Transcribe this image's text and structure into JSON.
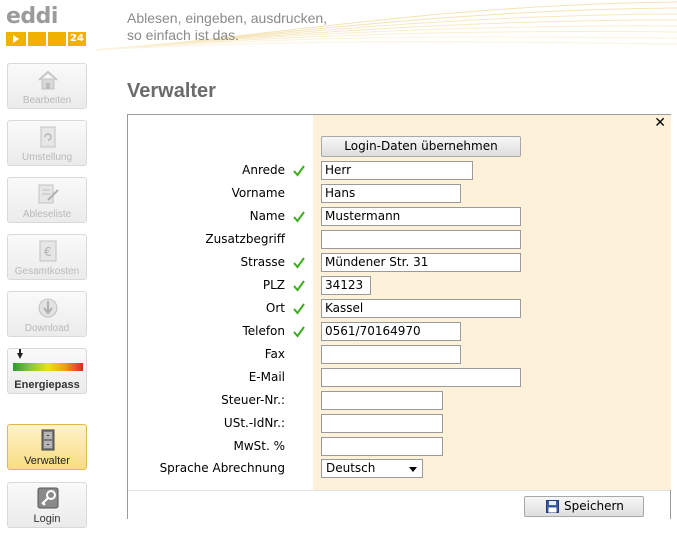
{
  "header": {
    "logo_text": "eddi",
    "logo_badge": "24",
    "tagline_line1": "Ablesen, eingeben, ausdrucken,",
    "tagline_line2": "so einfach ist das.",
    "brand_color": "#f0b200"
  },
  "sidebar": {
    "items": [
      {
        "label": "Bearbeiten",
        "icon": "house-icon",
        "state": "disabled"
      },
      {
        "label": "Umstellung",
        "icon": "document-refresh-icon",
        "state": "disabled"
      },
      {
        "label": "Ableseliste",
        "icon": "list-pen-icon",
        "state": "disabled"
      },
      {
        "label": "Gesamtkosten",
        "icon": "euro-document-icon",
        "state": "disabled"
      },
      {
        "label": "Download",
        "icon": "download-globe-icon",
        "state": "disabled"
      },
      {
        "label": "Energiepass",
        "icon": "energy-scale-icon",
        "state": "enabled"
      },
      {
        "label": "Verwalter",
        "icon": "cabinet-icon",
        "state": "active"
      },
      {
        "label": "Login",
        "icon": "key-icon",
        "state": "enabled"
      }
    ]
  },
  "page": {
    "title": "Verwalter"
  },
  "form": {
    "close_label": "✕",
    "login_button": "Login-Daten übernehmen",
    "fields": [
      {
        "label": "Anrede",
        "value": "Herr",
        "required": true
      },
      {
        "label": "Vorname",
        "value": "Hans",
        "required": false
      },
      {
        "label": "Name",
        "value": "Mustermann",
        "required": true
      },
      {
        "label": "Zusatzbegriff",
        "value": "",
        "required": false
      },
      {
        "label": "Strasse",
        "value": "Mündener Str. 31",
        "required": true
      },
      {
        "label": "PLZ",
        "value": "34123",
        "required": true
      },
      {
        "label": "Ort",
        "value": "Kassel",
        "required": true
      },
      {
        "label": "Telefon",
        "value": "0561/70164970",
        "required": true
      },
      {
        "label": "Fax",
        "value": "",
        "required": false
      },
      {
        "label": "E-Mail",
        "value": "",
        "required": false
      },
      {
        "label": "Steuer-Nr.:",
        "value": "",
        "required": false
      },
      {
        "label": "USt.-IdNr.:",
        "value": "",
        "required": false
      },
      {
        "label": "MwSt. %",
        "value": "",
        "required": false
      }
    ],
    "language": {
      "label": "Sprache Abrechnung",
      "value": "Deutsch"
    },
    "save_button": "Speichern",
    "check_color": "#3cae1e"
  }
}
